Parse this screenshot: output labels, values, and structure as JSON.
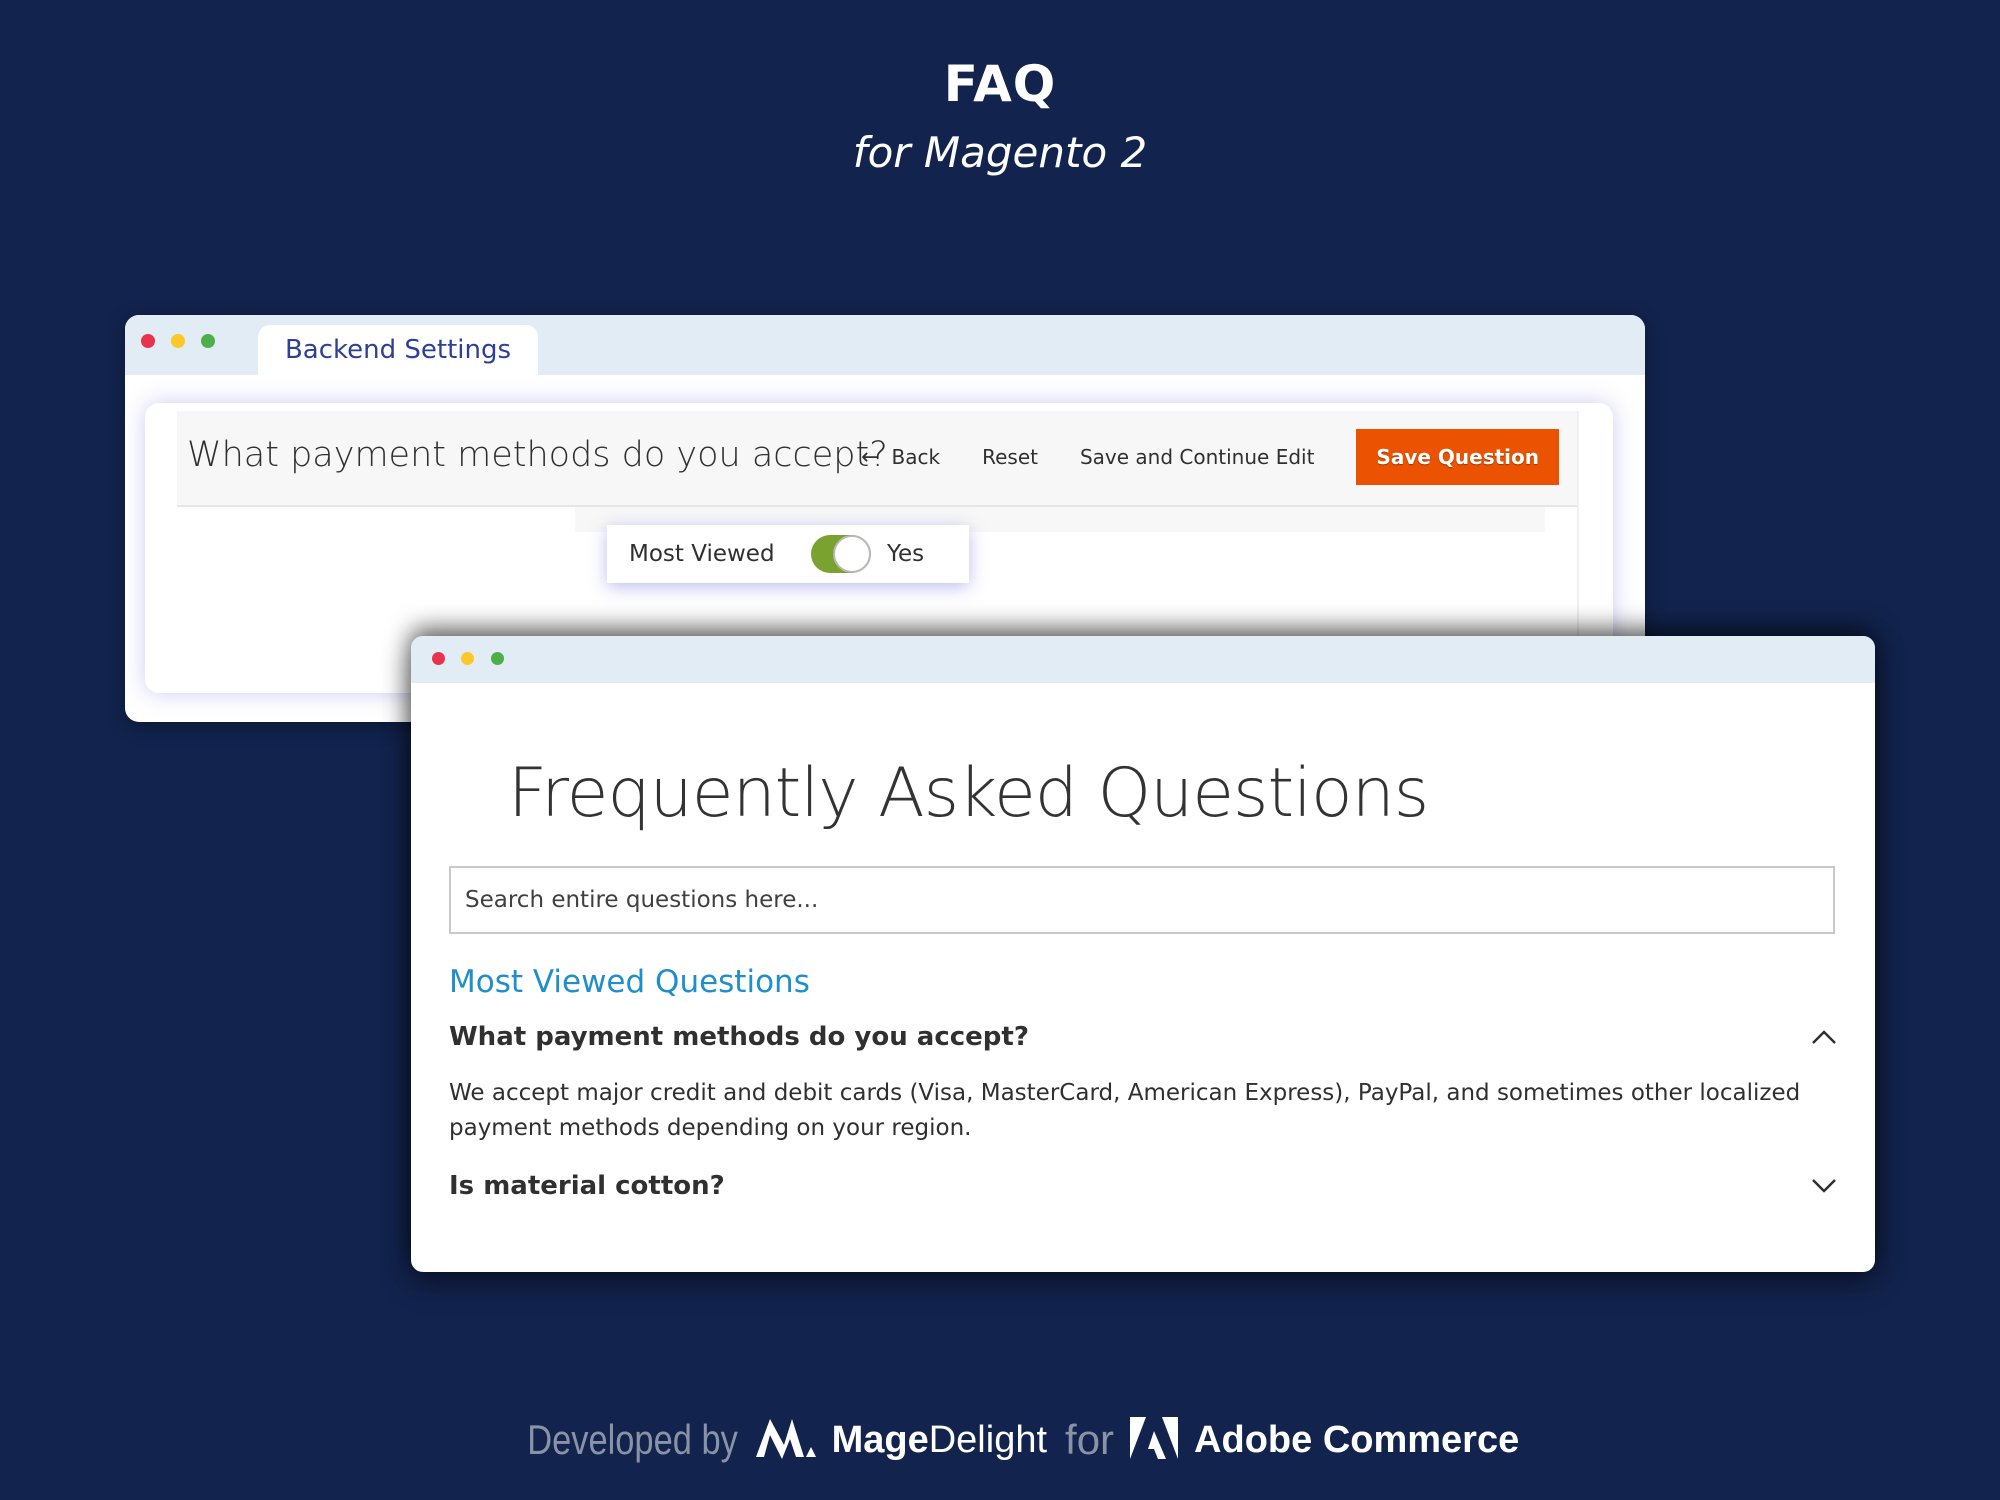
{
  "hero": {
    "title": "FAQ",
    "subtitle": "for Magento 2"
  },
  "backend_window": {
    "tab_label": "Backend Settings",
    "page_heading": "What payment methods do you accept?",
    "actions": {
      "back_label": "Back",
      "reset_label": "Reset",
      "save_continue_label": "Save and Continue Edit",
      "save_label": "Save Question"
    },
    "most_viewed": {
      "label": "Most Viewed",
      "enabled": true,
      "state_label": "Yes"
    }
  },
  "frontend_window": {
    "title": "Frequently Asked Questions",
    "search": {
      "placeholder": "Search entire questions here...",
      "value": ""
    },
    "section_heading": "Most Viewed Questions",
    "questions": [
      {
        "question": "What payment methods do you accept?",
        "expanded": true,
        "answer": "We accept major credit and debit cards (Visa, MasterCard, American Express), PayPal, and sometimes other localized payment methods depending on your region."
      },
      {
        "question": "Is material cotton?",
        "expanded": false
      }
    ]
  },
  "footer": {
    "developed_by": "Developed by",
    "brand_bold": "Mage",
    "brand_light": "Delight",
    "for_label": "for",
    "platform": "Adobe Commerce"
  },
  "colors": {
    "background": "#12234d",
    "accent_orange": "#eb5202",
    "toggle_green": "#79a22e",
    "link_blue": "#1f8ecc",
    "tab_text": "#2d3f97"
  }
}
